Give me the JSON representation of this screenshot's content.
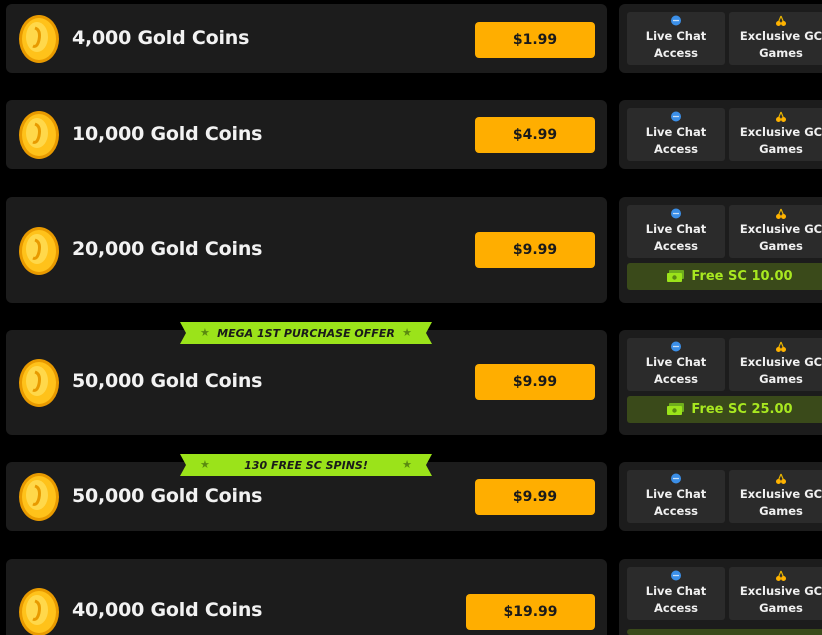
{
  "rows": [
    {
      "label": "4,000 Gold Coins",
      "price": "$1.99"
    },
    {
      "label": "10,000 Gold Coins",
      "price": "$4.99"
    },
    {
      "label": "20,000 Gold Coins",
      "price": "$9.99",
      "free_sc": "Free SC 10.00"
    },
    {
      "label": "50,000 Gold Coins",
      "price": "$9.99",
      "free_sc": "Free SC 25.00",
      "ribbon": "MEGA 1ST PURCHASE OFFER"
    },
    {
      "label": "50,000 Gold Coins",
      "price": "$9.99",
      "ribbon": "130 FREE SC SPINS!"
    },
    {
      "label": "40,000 Gold Coins",
      "price": "$19.99"
    }
  ],
  "perks": {
    "live_chat_line1": "Live Chat",
    "live_chat_line2": "Access",
    "exclusive_line1": "Exclusive GC",
    "exclusive_line2": "Games"
  },
  "colors": {
    "accent": "#ffae00",
    "green": "#a8e820",
    "card": "#1c1c1c",
    "ribbon": "#9be31a"
  },
  "icons": [
    "coin-icon",
    "chat-bubble-icon",
    "cherries-icon",
    "cash-icon",
    "star-icon"
  ]
}
